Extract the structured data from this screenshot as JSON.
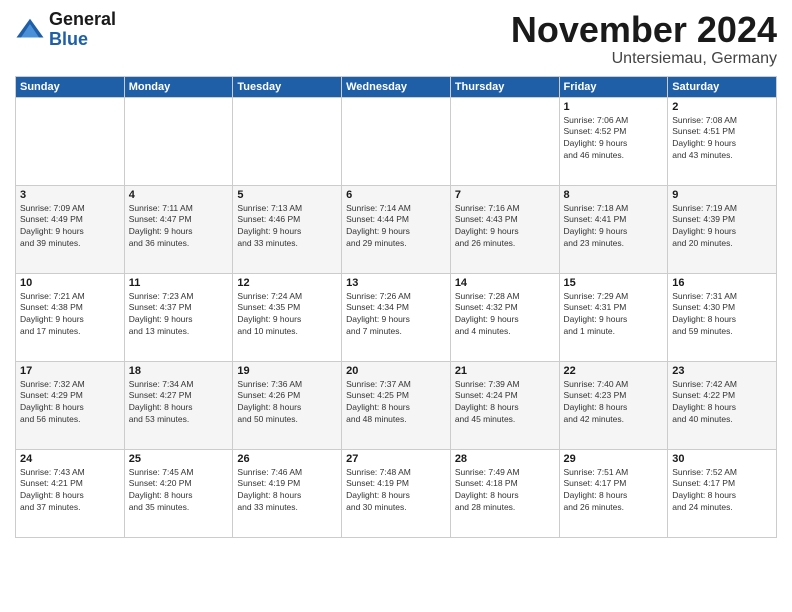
{
  "header": {
    "logo": {
      "line1": "General",
      "line2": "Blue"
    },
    "title": "November 2024",
    "location": "Untersiemau, Germany"
  },
  "weekdays": [
    "Sunday",
    "Monday",
    "Tuesday",
    "Wednesday",
    "Thursday",
    "Friday",
    "Saturday"
  ],
  "weeks": [
    [
      {
        "day": "",
        "info": ""
      },
      {
        "day": "",
        "info": ""
      },
      {
        "day": "",
        "info": ""
      },
      {
        "day": "",
        "info": ""
      },
      {
        "day": "",
        "info": ""
      },
      {
        "day": "1",
        "info": "Sunrise: 7:06 AM\nSunset: 4:52 PM\nDaylight: 9 hours\nand 46 minutes."
      },
      {
        "day": "2",
        "info": "Sunrise: 7:08 AM\nSunset: 4:51 PM\nDaylight: 9 hours\nand 43 minutes."
      }
    ],
    [
      {
        "day": "3",
        "info": "Sunrise: 7:09 AM\nSunset: 4:49 PM\nDaylight: 9 hours\nand 39 minutes."
      },
      {
        "day": "4",
        "info": "Sunrise: 7:11 AM\nSunset: 4:47 PM\nDaylight: 9 hours\nand 36 minutes."
      },
      {
        "day": "5",
        "info": "Sunrise: 7:13 AM\nSunset: 4:46 PM\nDaylight: 9 hours\nand 33 minutes."
      },
      {
        "day": "6",
        "info": "Sunrise: 7:14 AM\nSunset: 4:44 PM\nDaylight: 9 hours\nand 29 minutes."
      },
      {
        "day": "7",
        "info": "Sunrise: 7:16 AM\nSunset: 4:43 PM\nDaylight: 9 hours\nand 26 minutes."
      },
      {
        "day": "8",
        "info": "Sunrise: 7:18 AM\nSunset: 4:41 PM\nDaylight: 9 hours\nand 23 minutes."
      },
      {
        "day": "9",
        "info": "Sunrise: 7:19 AM\nSunset: 4:39 PM\nDaylight: 9 hours\nand 20 minutes."
      }
    ],
    [
      {
        "day": "10",
        "info": "Sunrise: 7:21 AM\nSunset: 4:38 PM\nDaylight: 9 hours\nand 17 minutes."
      },
      {
        "day": "11",
        "info": "Sunrise: 7:23 AM\nSunset: 4:37 PM\nDaylight: 9 hours\nand 13 minutes."
      },
      {
        "day": "12",
        "info": "Sunrise: 7:24 AM\nSunset: 4:35 PM\nDaylight: 9 hours\nand 10 minutes."
      },
      {
        "day": "13",
        "info": "Sunrise: 7:26 AM\nSunset: 4:34 PM\nDaylight: 9 hours\nand 7 minutes."
      },
      {
        "day": "14",
        "info": "Sunrise: 7:28 AM\nSunset: 4:32 PM\nDaylight: 9 hours\nand 4 minutes."
      },
      {
        "day": "15",
        "info": "Sunrise: 7:29 AM\nSunset: 4:31 PM\nDaylight: 9 hours\nand 1 minute."
      },
      {
        "day": "16",
        "info": "Sunrise: 7:31 AM\nSunset: 4:30 PM\nDaylight: 8 hours\nand 59 minutes."
      }
    ],
    [
      {
        "day": "17",
        "info": "Sunrise: 7:32 AM\nSunset: 4:29 PM\nDaylight: 8 hours\nand 56 minutes."
      },
      {
        "day": "18",
        "info": "Sunrise: 7:34 AM\nSunset: 4:27 PM\nDaylight: 8 hours\nand 53 minutes."
      },
      {
        "day": "19",
        "info": "Sunrise: 7:36 AM\nSunset: 4:26 PM\nDaylight: 8 hours\nand 50 minutes."
      },
      {
        "day": "20",
        "info": "Sunrise: 7:37 AM\nSunset: 4:25 PM\nDaylight: 8 hours\nand 48 minutes."
      },
      {
        "day": "21",
        "info": "Sunrise: 7:39 AM\nSunset: 4:24 PM\nDaylight: 8 hours\nand 45 minutes."
      },
      {
        "day": "22",
        "info": "Sunrise: 7:40 AM\nSunset: 4:23 PM\nDaylight: 8 hours\nand 42 minutes."
      },
      {
        "day": "23",
        "info": "Sunrise: 7:42 AM\nSunset: 4:22 PM\nDaylight: 8 hours\nand 40 minutes."
      }
    ],
    [
      {
        "day": "24",
        "info": "Sunrise: 7:43 AM\nSunset: 4:21 PM\nDaylight: 8 hours\nand 37 minutes."
      },
      {
        "day": "25",
        "info": "Sunrise: 7:45 AM\nSunset: 4:20 PM\nDaylight: 8 hours\nand 35 minutes."
      },
      {
        "day": "26",
        "info": "Sunrise: 7:46 AM\nSunset: 4:19 PM\nDaylight: 8 hours\nand 33 minutes."
      },
      {
        "day": "27",
        "info": "Sunrise: 7:48 AM\nSunset: 4:19 PM\nDaylight: 8 hours\nand 30 minutes."
      },
      {
        "day": "28",
        "info": "Sunrise: 7:49 AM\nSunset: 4:18 PM\nDaylight: 8 hours\nand 28 minutes."
      },
      {
        "day": "29",
        "info": "Sunrise: 7:51 AM\nSunset: 4:17 PM\nDaylight: 8 hours\nand 26 minutes."
      },
      {
        "day": "30",
        "info": "Sunrise: 7:52 AM\nSunset: 4:17 PM\nDaylight: 8 hours\nand 24 minutes."
      }
    ]
  ]
}
